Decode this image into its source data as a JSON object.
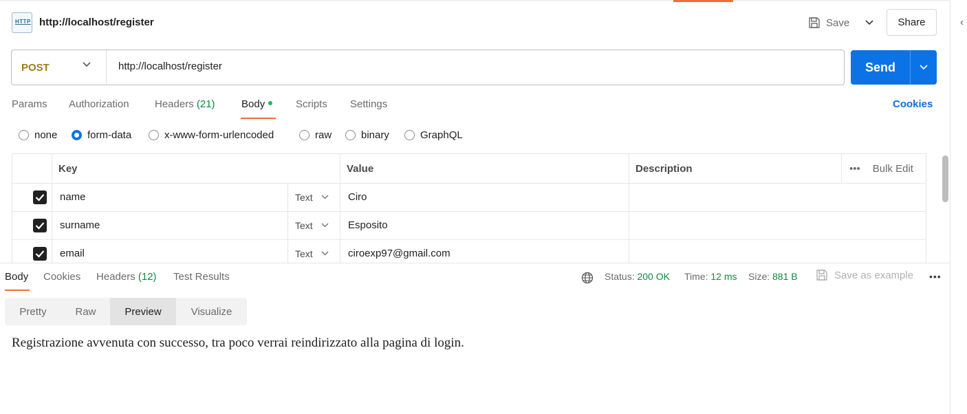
{
  "header": {
    "icon_label": "HTTP",
    "title": "http://localhost/register",
    "save_label": "Save",
    "share_label": "Share"
  },
  "request": {
    "method": "POST",
    "url": "http://localhost/register",
    "send_label": "Send"
  },
  "request_tabs": [
    {
      "label": "Params"
    },
    {
      "label": "Authorization"
    },
    {
      "label": "Headers",
      "count": "(21)"
    },
    {
      "label": "Body"
    },
    {
      "label": "Scripts"
    },
    {
      "label": "Settings"
    }
  ],
  "cookies_label": "Cookies",
  "body_modes": [
    "none",
    "form-data",
    "x-www-form-urlencoded",
    "raw",
    "binary",
    "GraphQL"
  ],
  "selected_body_mode": "form-data",
  "table": {
    "headers": {
      "key": "Key",
      "value": "Value",
      "description": "Description",
      "bulk_edit": "Bulk Edit"
    },
    "rows": [
      {
        "key": "name",
        "type": "Text",
        "value": "Ciro",
        "description": ""
      },
      {
        "key": "surname",
        "type": "Text",
        "value": "Esposito",
        "description": ""
      },
      {
        "key": "email",
        "type": "Text",
        "value": "ciroexp97@gmail.com",
        "description": ""
      }
    ]
  },
  "response": {
    "tabs": [
      {
        "label": "Body"
      },
      {
        "label": "Cookies"
      },
      {
        "label": "Headers",
        "count": "(12)"
      },
      {
        "label": "Test Results"
      }
    ],
    "status_label": "Status:",
    "status_value": "200 OK",
    "time_label": "Time:",
    "time_value": "12 ms",
    "size_label": "Size:",
    "size_value": "881 B",
    "save_example_label": "Save as example",
    "views": [
      "Pretty",
      "Raw",
      "Preview",
      "Visualize"
    ],
    "active_view": "Preview",
    "preview_text": "Registrazione avvenuta con successo, tra poco verrai reindirizzato alla pagina di login."
  },
  "colors": {
    "accent_orange": "#f26b3a",
    "send_blue": "#0c73e6",
    "method_post": "#a07b1f",
    "success_green": "#0c8a3e"
  }
}
